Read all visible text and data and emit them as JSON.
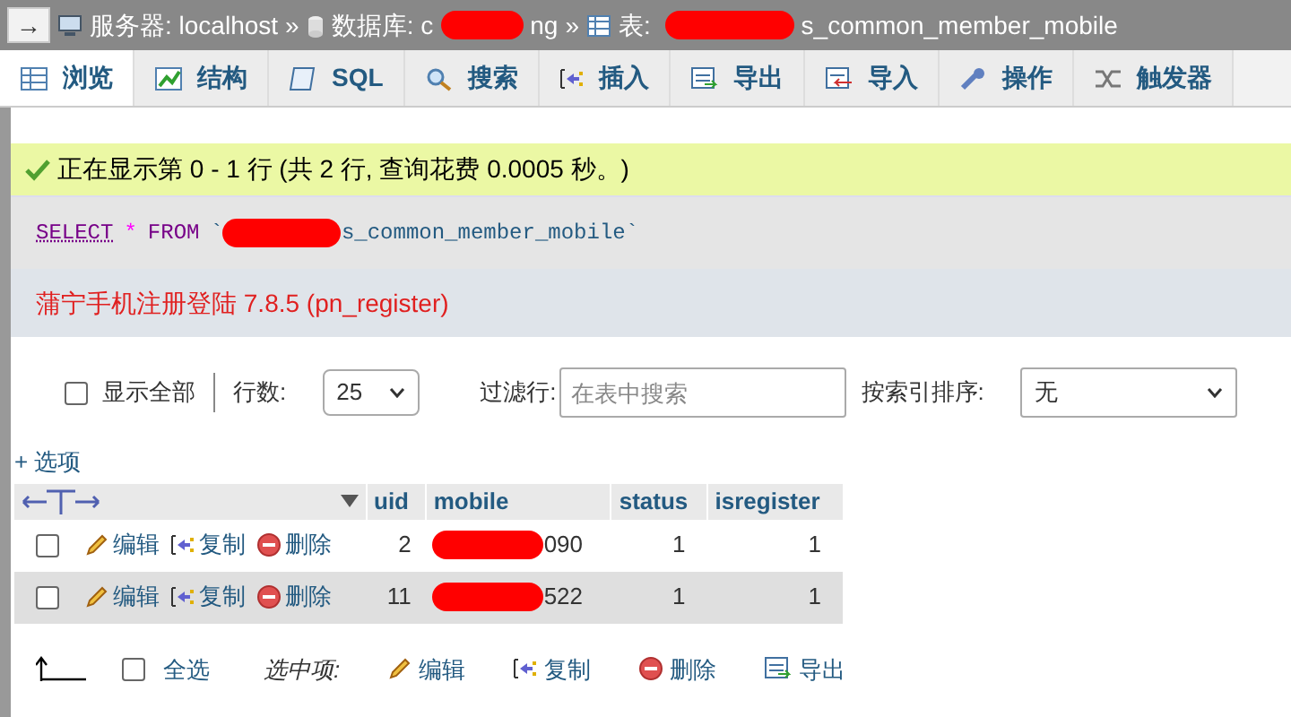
{
  "breadcrumb": {
    "nav_glyph": "→",
    "items": [
      {
        "kind": "server",
        "parts": [
          {
            "kind": "text",
            "text": "服务器: localhost"
          }
        ]
      },
      {
        "kind": "database",
        "separator": "»",
        "parts": [
          {
            "kind": "text",
            "text": "数据库: c"
          },
          {
            "kind": "redacted"
          },
          {
            "kind": "text",
            "text": "ng"
          }
        ]
      },
      {
        "kind": "table",
        "separator": "»",
        "parts": [
          {
            "kind": "text",
            "text": "表: "
          },
          {
            "kind": "redacted"
          },
          {
            "kind": "text",
            "text": "s_common_member_mobile"
          }
        ]
      }
    ]
  },
  "tabs": [
    {
      "label": "浏览",
      "kind": "browse",
      "selected": true
    },
    {
      "label": "结构",
      "kind": "structure",
      "selected": false
    },
    {
      "label": "SQL",
      "kind": "sql",
      "selected": false
    },
    {
      "label": "搜索",
      "kind": "search",
      "selected": false
    },
    {
      "label": "插入",
      "kind": "insert",
      "selected": false
    },
    {
      "label": "导出",
      "kind": "export",
      "selected": false
    },
    {
      "label": "导入",
      "kind": "import",
      "selected": false
    },
    {
      "label": "操作",
      "kind": "operations",
      "selected": false
    },
    {
      "label": "触发器",
      "kind": "triggers",
      "selected": false
    }
  ],
  "success_message": "正在显示第 0 - 1 行 (共 2 行, 查询花费 0.0005 秒。)",
  "sql_query": {
    "keyword_select": "SELECT",
    "star": "*",
    "keyword_from": "FROM",
    "open_quote": "`",
    "table_suffix": "s_common_member_mobile",
    "close_quote": "`"
  },
  "plugin_notice": "蒲宁手机注册登陆 7.8.5 (pn_register)",
  "controls": {
    "show_all": {
      "label": "显示全部",
      "checked": false
    },
    "rows_label": "行数:",
    "rows_value": "25",
    "filter_label": "过滤行:",
    "filter_placeholder": "在表中搜索",
    "sort_label": "按索引排序:",
    "sort_value": "无"
  },
  "options_link": "+ 选项",
  "table": {
    "columns": [
      "uid",
      "mobile",
      "status",
      "isregister"
    ],
    "rows": [
      {
        "checked": false,
        "actions": [
          "编辑",
          "复制",
          "删除"
        ],
        "uid": "2",
        "mobile_visible": "090",
        "status": "1",
        "isregister": "1"
      },
      {
        "checked": false,
        "actions": [
          "编辑",
          "复制",
          "删除"
        ],
        "uid": "11",
        "mobile_visible": "522",
        "status": "1",
        "isregister": "1"
      }
    ]
  },
  "bulk": {
    "select_all": {
      "label": "全选",
      "checked": false
    },
    "with_selected": "选中项:",
    "actions": [
      {
        "kind": "edit",
        "label": "编辑"
      },
      {
        "kind": "copy",
        "label": "复制"
      },
      {
        "kind": "delete",
        "label": "删除"
      },
      {
        "kind": "export",
        "label": "导出"
      }
    ]
  }
}
